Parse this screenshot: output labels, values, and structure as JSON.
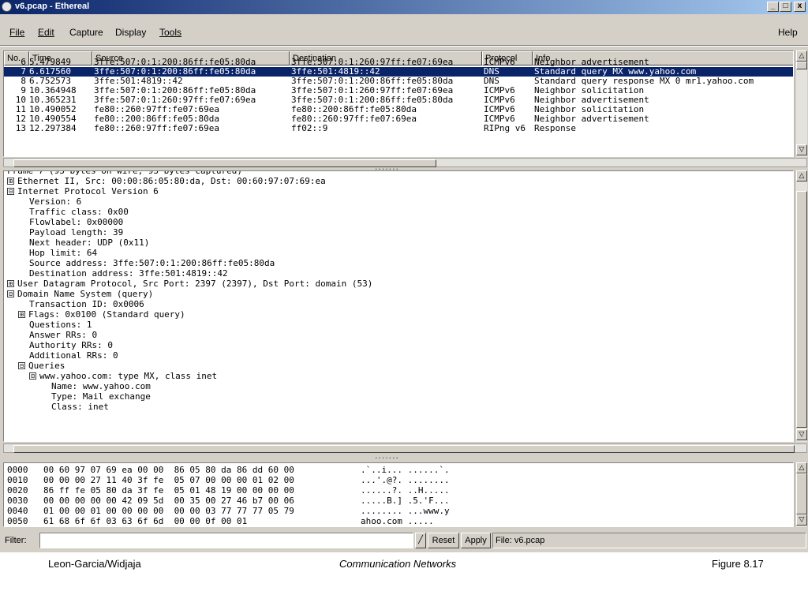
{
  "window": {
    "title": "v6.pcap - Ethereal",
    "minimize": "_",
    "maximize": "□",
    "close": "x"
  },
  "menu": {
    "items": [
      "File",
      "Edit",
      "Capture",
      "Display",
      "Tools"
    ],
    "help": "Help"
  },
  "packet_list": {
    "columns": [
      "No. .",
      "Time",
      "Source",
      "Destination",
      "Protocol",
      "Info"
    ],
    "rows": [
      {
        "no": "6",
        "time": "5.479849",
        "source": "3ffe:507:0:1:200:86ff:fe05:80da",
        "destination": "3ffe:507:0:1:260:97ff:fe07:69ea",
        "protocol": "ICMPv6",
        "info": "Neighbor advertisement"
      },
      {
        "no": "7",
        "time": "6.617560",
        "source": "3ffe:507:0:1:200:86ff:fe05:80da",
        "destination": "3ffe:501:4819::42",
        "protocol": "DNS",
        "info": "Standard query MX www.yahoo.com"
      },
      {
        "no": "8",
        "time": "6.752573",
        "source": "3ffe:501:4819::42",
        "destination": "3ffe:507:0:1:200:86ff:fe05:80da",
        "protocol": "DNS",
        "info": "Standard query response MX 0 mr1.yahoo.com"
      },
      {
        "no": "9",
        "time": "10.364948",
        "source": "3ffe:507:0:1:200:86ff:fe05:80da",
        "destination": "3ffe:507:0:1:260:97ff:fe07:69ea",
        "protocol": "ICMPv6",
        "info": "Neighbor solicitation"
      },
      {
        "no": "10",
        "time": "10.365231",
        "source": "3ffe:507:0:1:260:97ff:fe07:69ea",
        "destination": "3ffe:507:0:1:200:86ff:fe05:80da",
        "protocol": "ICMPv6",
        "info": "Neighbor advertisement"
      },
      {
        "no": "11",
        "time": "10.490052",
        "source": "fe80::260:97ff:fe07:69ea",
        "destination": "fe80::200:86ff:fe05:80da",
        "protocol": "ICMPv6",
        "info": "Neighbor solicitation"
      },
      {
        "no": "12",
        "time": "10.490554",
        "source": "fe80::200:86ff:fe05:80da",
        "destination": "fe80::260:97ff:fe07:69ea",
        "protocol": "ICMPv6",
        "info": "Neighbor advertisement"
      },
      {
        "no": "13",
        "time": "12.297384",
        "source": "fe80::260:97ff:fe07:69ea",
        "destination": "ff02::9",
        "protocol": "RIPng v6",
        "info": "Response"
      }
    ]
  },
  "details": [
    {
      "toggle": "",
      "text": "Frame 7 (93 bytes on wire, 93 bytes captured)"
    },
    {
      "toggle": "⊞",
      "text": "Ethernet II, Src: 00:00:86:05:80:da, Dst: 00:60:97:07:69:ea"
    },
    {
      "toggle": "⊟",
      "text": "Internet Protocol Version 6"
    },
    {
      "toggle": "",
      "text": "Version: 6"
    },
    {
      "toggle": "",
      "text": "Traffic class: 0x00"
    },
    {
      "toggle": "",
      "text": "Flowlabel: 0x00000"
    },
    {
      "toggle": "",
      "text": "Payload length: 39"
    },
    {
      "toggle": "",
      "text": "Next header: UDP (0x11)"
    },
    {
      "toggle": "",
      "text": "Hop limit: 64"
    },
    {
      "toggle": "",
      "text": "Source address: 3ffe:507:0:1:200:86ff:fe05:80da"
    },
    {
      "toggle": "",
      "text": "Destination address: 3ffe:501:4819::42"
    },
    {
      "toggle": "⊞",
      "text": "User Datagram Protocol, Src Port: 2397 (2397), Dst Port: domain (53)"
    },
    {
      "toggle": "⊟",
      "text": "Domain Name System (query)"
    },
    {
      "toggle": "",
      "text": "Transaction ID: 0x0006"
    },
    {
      "toggle": "⊞",
      "text": "Flags: 0x0100 (Standard query)"
    },
    {
      "toggle": "",
      "text": "Questions: 1"
    },
    {
      "toggle": "",
      "text": "Answer RRs: 0"
    },
    {
      "toggle": "",
      "text": "Authority RRs: 0"
    },
    {
      "toggle": "",
      "text": "Additional RRs: 0"
    },
    {
      "toggle": "⊟",
      "text": "Queries"
    },
    {
      "toggle": "⊟",
      "text": "www.yahoo.com: type MX, class inet"
    },
    {
      "toggle": "",
      "text": "Name: www.yahoo.com"
    },
    {
      "toggle": "",
      "text": "Type: Mail exchange"
    },
    {
      "toggle": "",
      "text": "Class: inet"
    }
  ],
  "hex_dump": [
    {
      "offset": "0000",
      "bytes": "00 60 97 07 69 ea 00 00  86 05 80 da 86 dd 60 00",
      "ascii": ".`..i... ......`."
    },
    {
      "offset": "0010",
      "bytes": "00 00 00 27 11 40 3f fe  05 07 00 00 00 01 02 00",
      "ascii": "...'.@?. ........"
    },
    {
      "offset": "0020",
      "bytes": "86 ff fe 05 80 da 3f fe  05 01 48 19 00 00 00 00",
      "ascii": "......?. ..H....."
    },
    {
      "offset": "0030",
      "bytes": "00 00 00 00 00 42 09 5d  00 35 00 27 46 b7 00 06",
      "ascii": ".....B.] .5.'F..."
    },
    {
      "offset": "0040",
      "bytes": "01 00 00 01 00 00 00 00  00 00 03 77 77 77 05 79",
      "ascii": "........ ...www.y"
    },
    {
      "offset": "0050",
      "bytes": "61 68 6f 6f 03 63 6f 6d  00 00 0f 00 01",
      "ascii": "ahoo.com ....."
    }
  ],
  "filter": {
    "label": "Filter:",
    "value": "",
    "reset_label": "Reset",
    "apply_label": "Apply",
    "file_status": "File: v6.pcap"
  },
  "captions": {
    "left": "Leon-Garcia/Widjaja",
    "center": "Communication Networks",
    "right": "Figure 8.17"
  },
  "colors": {
    "selection": "#0a246a",
    "window_bg": "#d4d0c8"
  }
}
